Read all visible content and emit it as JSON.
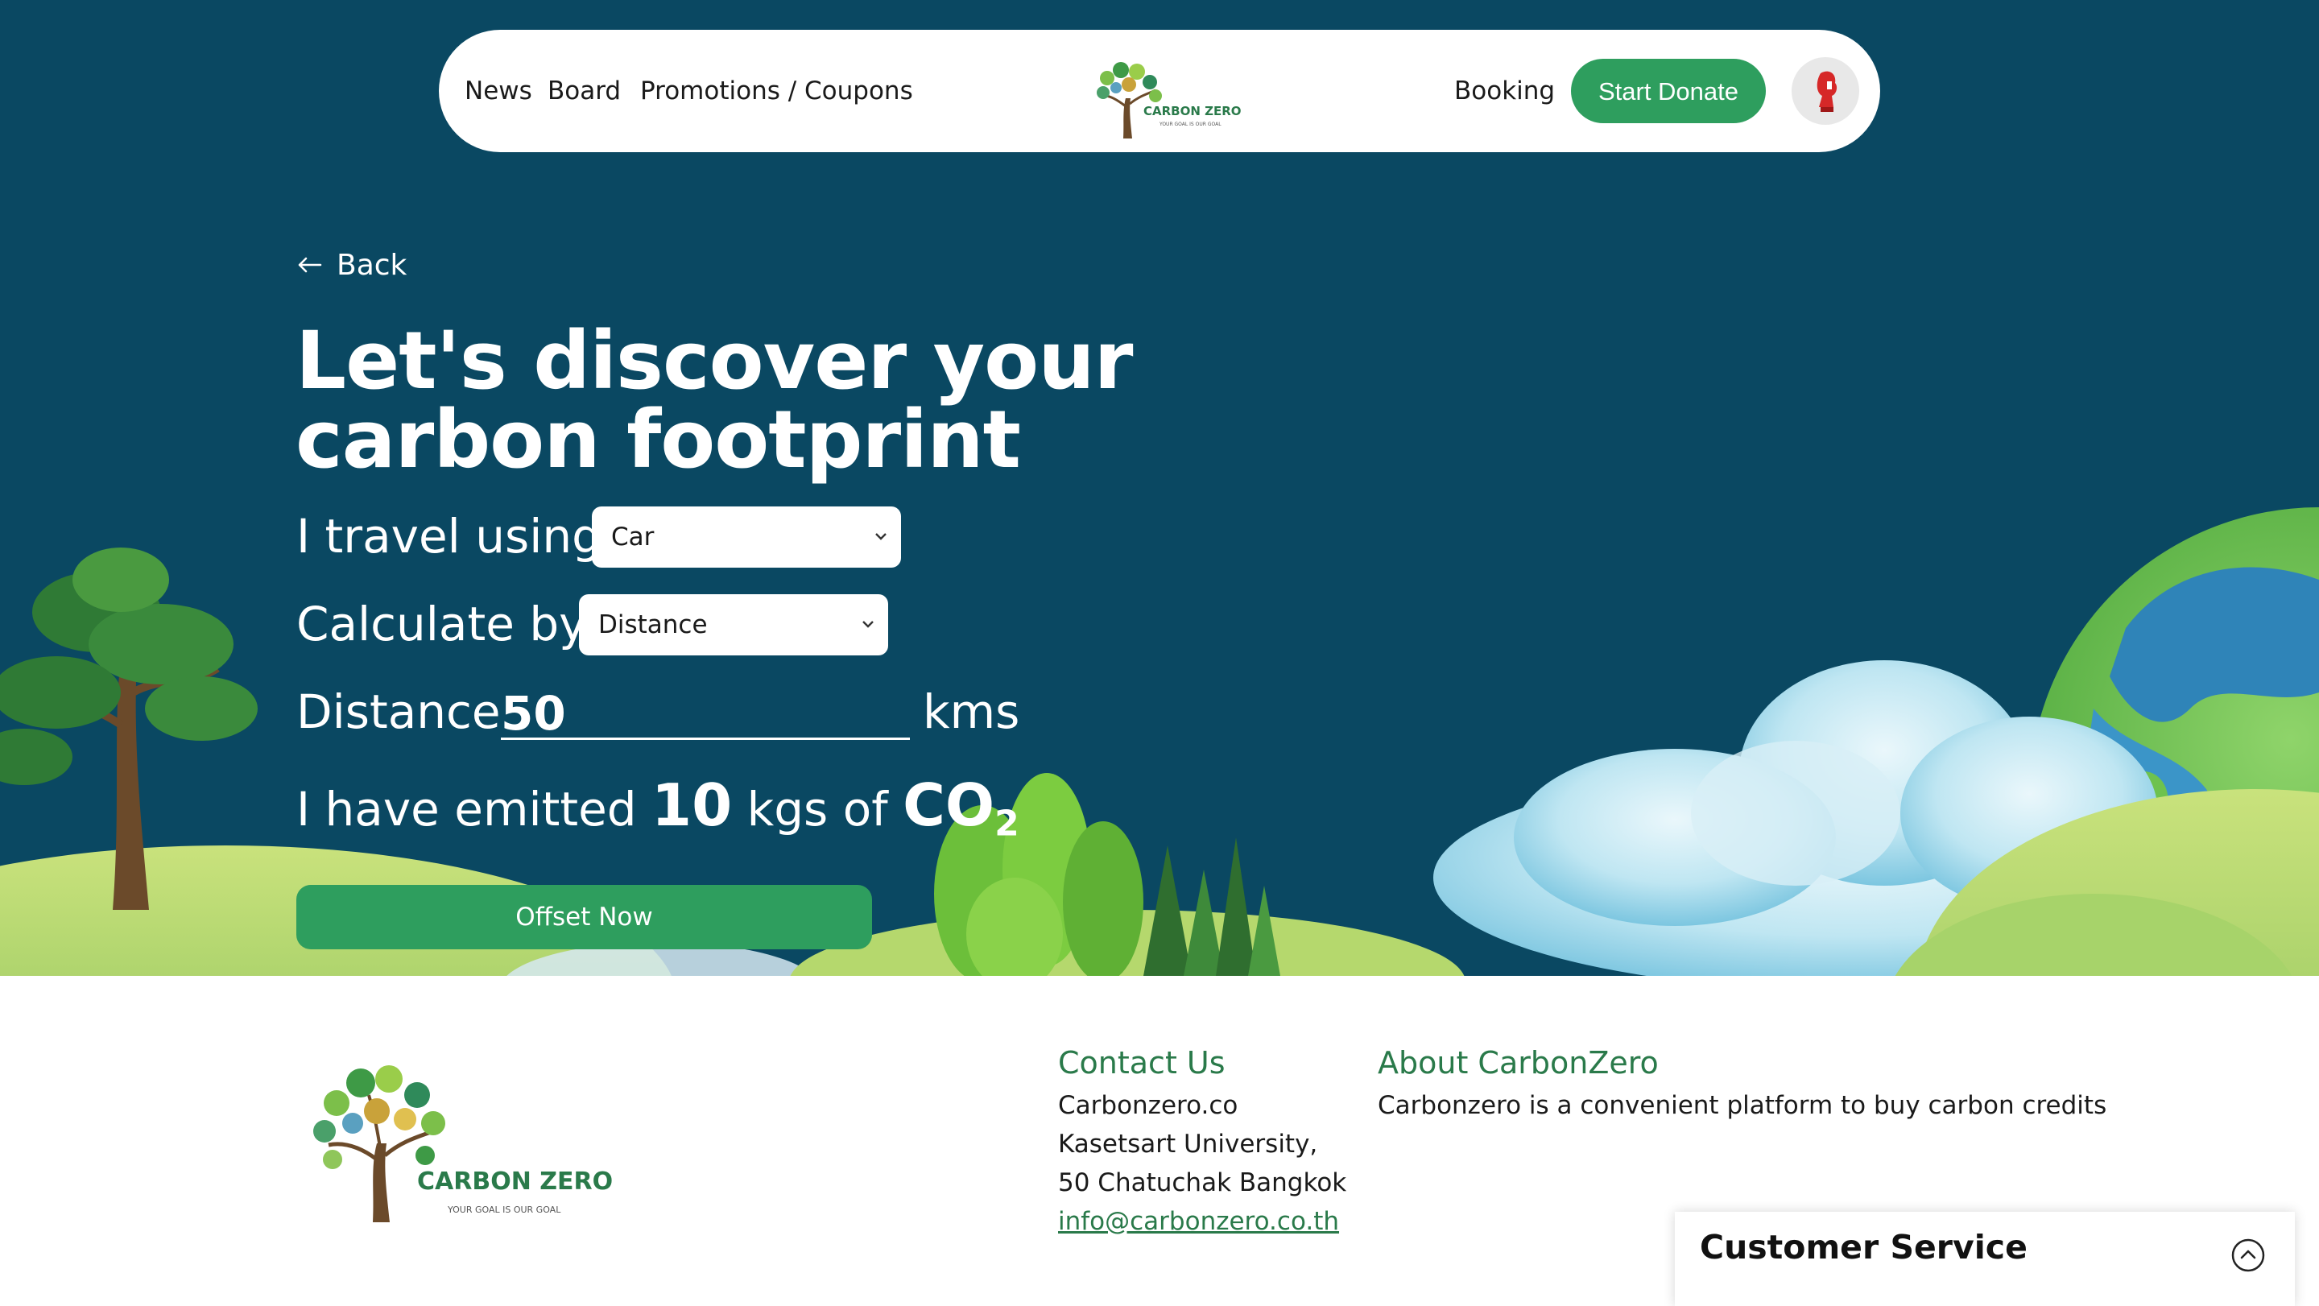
{
  "nav": {
    "news": "News",
    "board": "Board",
    "promotions": "Promotions / Coupons",
    "logo_name": "CARBON ZERO",
    "logo_tagline": "YOUR GOAL IS OUR GOAL",
    "booking": "Booking",
    "start_donate": "Start Donate"
  },
  "page": {
    "back": "Back",
    "title": "Let's discover your carbon footprint",
    "travel_label": "I travel using",
    "travel_value": "Car",
    "calc_label": "Calculate by",
    "calc_value": "Distance",
    "distance_label": "Distance",
    "distance_value": "50",
    "distance_unit": "kms",
    "emission_prefix": "I have emitted",
    "emission_value": "10",
    "emission_middle": "kgs of",
    "emission_co": "CO",
    "emission_sub": "2",
    "offset_button": "Offset Now"
  },
  "footer": {
    "logo_name": "CARBON ZERO",
    "logo_tagline": "YOUR GOAL IS OUR GOAL",
    "contact_heading": "Contact Us",
    "contact_company": "Carbonzero.co",
    "contact_address1": "Kasetsart University,",
    "contact_address2": "50 Chatuchak Bangkok",
    "contact_email": "info@carbonzero.co.th",
    "about_heading": "About CarbonZero",
    "about_text": "Carbonzero is a convenient platform to buy carbon credits"
  },
  "customer_service": {
    "title": "Customer Service"
  },
  "colors": {
    "hero_background": "#0a4862",
    "accent_green": "#2e9e5e",
    "heading_green": "#2a7a4a"
  },
  "icons": {
    "back": "arrow-left-icon",
    "select_chevron": "chevron-down-icon",
    "cs_toggle": "chevron-up-circle-icon"
  }
}
